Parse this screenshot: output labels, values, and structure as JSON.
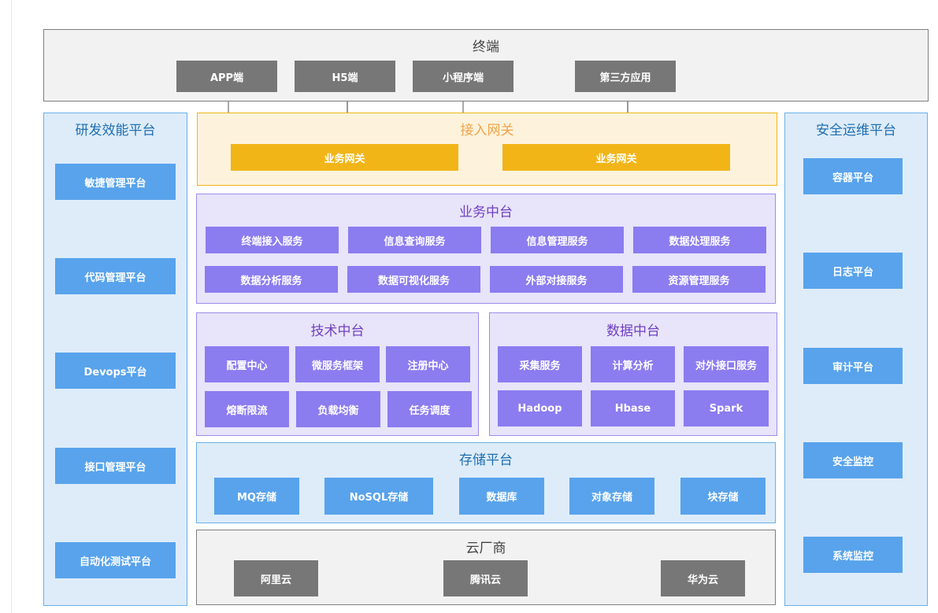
{
  "terminal": {
    "title": "终端",
    "items": [
      "APP端",
      "H5端",
      "小程序端",
      "第三方应用"
    ]
  },
  "gateway": {
    "title": "接入网关",
    "items": [
      "业务网关",
      "业务网关"
    ]
  },
  "business": {
    "title": "业务中台",
    "items": [
      "终端接入服务",
      "信息查询服务",
      "信息管理服务",
      "数据处理服务",
      "数据分析服务",
      "数据可视化服务",
      "外部对接服务",
      "资源管理服务"
    ]
  },
  "tech": {
    "title": "技术中台",
    "items": [
      "配置中心",
      "微服务框架",
      "注册中心",
      "熔断限流",
      "负载均衡",
      "任务调度"
    ]
  },
  "data_platform": {
    "title": "数据中台",
    "items": [
      "采集服务",
      "计算分析",
      "对外接口服务",
      "Hadoop",
      "Hbase",
      "Spark"
    ]
  },
  "storage": {
    "title": "存储平台",
    "items": [
      "MQ存储",
      "NoSQL存储",
      "数据库",
      "对象存储",
      "块存储"
    ]
  },
  "cloud": {
    "title": "云厂商",
    "items": [
      "阿里云",
      "腾讯云",
      "华为云"
    ]
  },
  "devops": {
    "title": "研发效能平台",
    "items": [
      "敏捷管理平台",
      "代码管理平台",
      "Devops平台",
      "接口管理平台",
      "自动化测试平台"
    ]
  },
  "secops": {
    "title": "安全运维平台",
    "items": [
      "容器平台",
      "日志平台",
      "审计平台",
      "安全监控",
      "系统监控"
    ]
  },
  "colors": {
    "terminal_box": "#777777",
    "gateway_box": "#f2b518",
    "gateway_title": "#f0a54a",
    "middle_box": "#8b7cf0",
    "middle_title": "#7040c0",
    "blue_box": "#58a3ec",
    "blue_title": "#1f6fb0"
  }
}
